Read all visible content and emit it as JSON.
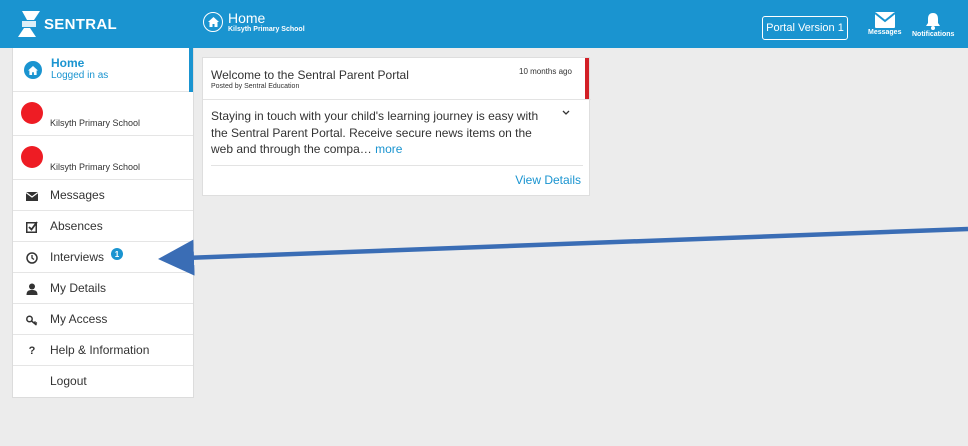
{
  "topbar": {
    "logo_text": "SENTRAL",
    "title": "Home",
    "subtitle": "Kilsyth Primary School",
    "portal_button": "Portal Version 1",
    "messages_label": "Messages",
    "notifications_label": "Notifications",
    "color": "#1a94d0"
  },
  "sidebar": {
    "home_title": "Home",
    "home_subtitle": "Logged in as",
    "schools": [
      "Kilsyth Primary School",
      "Kilsyth Primary School"
    ],
    "items": [
      {
        "label": "Messages",
        "icon": "envelope-icon"
      },
      {
        "label": "Absences",
        "icon": "checkbox-icon"
      },
      {
        "label": "Interviews",
        "icon": "clock-icon",
        "badge": "1"
      },
      {
        "label": "My Details",
        "icon": "user-icon"
      },
      {
        "label": "My Access",
        "icon": "key-icon"
      },
      {
        "label": "Help & Information",
        "icon": "question-icon"
      },
      {
        "label": "Logout"
      }
    ]
  },
  "card": {
    "title": "Welcome to the Sentral Parent Portal",
    "posted_by": "Posted by Sentral Education",
    "time": "10 months ago",
    "body": "Staying in touch with your child's learning journey is easy with the Sentral Parent Portal. Receive secure news items on the web and through the compa…",
    "more": "more",
    "view_details": "View Details"
  }
}
